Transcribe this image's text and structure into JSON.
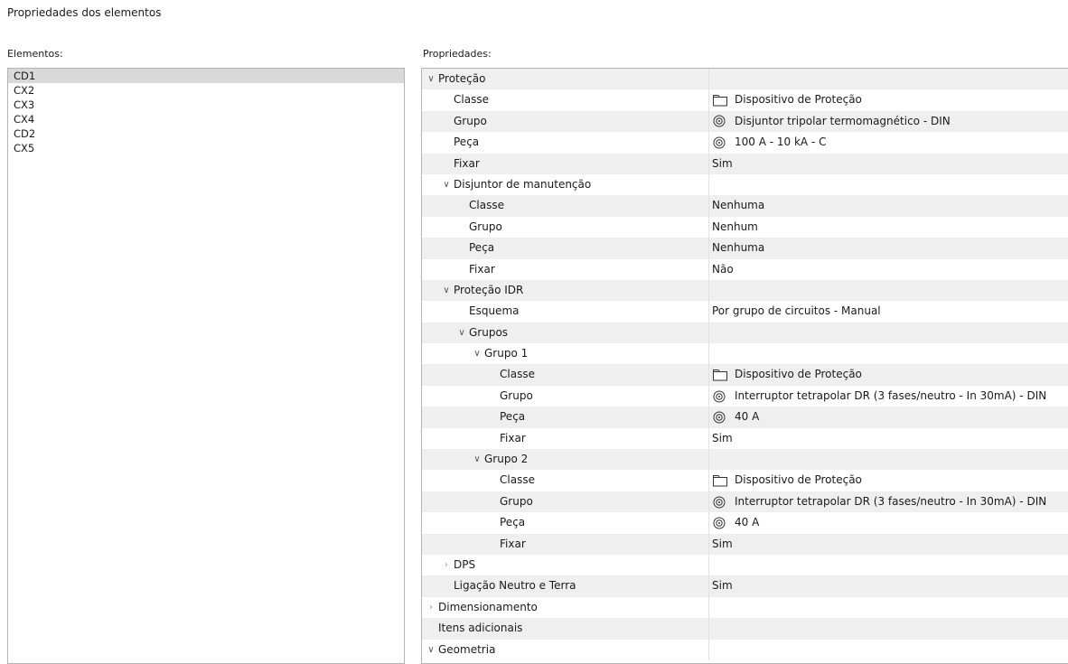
{
  "window": {
    "title": "Propriedades dos elementos"
  },
  "elements": {
    "label": "Elementos:",
    "items": [
      "CD1",
      "CX2",
      "CX3",
      "CX4",
      "CD2",
      "CX5"
    ],
    "selected": "CD1"
  },
  "properties": {
    "label": "Propriedades:",
    "rows": [
      {
        "name": "Proteção",
        "value": "",
        "depth": 0,
        "expander": "expanded",
        "icon": ""
      },
      {
        "name": "Classe",
        "value": "Dispositivo de Proteção",
        "depth": 1,
        "expander": "",
        "icon": "folder-icon"
      },
      {
        "name": "Grupo",
        "value": "Disjuntor tripolar termomagnético - DIN",
        "depth": 1,
        "expander": "",
        "icon": "target-icon"
      },
      {
        "name": "Peça",
        "value": "100 A - 10 kA - C",
        "depth": 1,
        "expander": "",
        "icon": "target-icon"
      },
      {
        "name": "Fixar",
        "value": "Sim",
        "depth": 1,
        "expander": "",
        "icon": ""
      },
      {
        "name": "Disjuntor de manutenção",
        "value": "",
        "depth": 1,
        "expander": "expanded",
        "icon": ""
      },
      {
        "name": "Classe",
        "value": "Nenhuma",
        "depth": 2,
        "expander": "",
        "icon": ""
      },
      {
        "name": "Grupo",
        "value": "Nenhum",
        "depth": 2,
        "expander": "",
        "icon": ""
      },
      {
        "name": "Peça",
        "value": "Nenhuma",
        "depth": 2,
        "expander": "",
        "icon": ""
      },
      {
        "name": "Fixar",
        "value": "Não",
        "depth": 2,
        "expander": "",
        "icon": ""
      },
      {
        "name": "Proteção IDR",
        "value": "",
        "depth": 1,
        "expander": "expanded",
        "icon": ""
      },
      {
        "name": "Esquema",
        "value": "Por grupo de circuitos - Manual",
        "depth": 2,
        "expander": "",
        "icon": ""
      },
      {
        "name": "Grupos",
        "value": "",
        "depth": 2,
        "expander": "expanded",
        "icon": ""
      },
      {
        "name": "Grupo 1",
        "value": "",
        "depth": 3,
        "expander": "expanded",
        "icon": ""
      },
      {
        "name": "Classe",
        "value": "Dispositivo de Proteção",
        "depth": 4,
        "expander": "",
        "icon": "folder-icon"
      },
      {
        "name": "Grupo",
        "value": "Interruptor tetrapolar DR (3 fases/neutro - In 30mA) - DIN",
        "depth": 4,
        "expander": "",
        "icon": "target-icon"
      },
      {
        "name": "Peça",
        "value": "40 A",
        "depth": 4,
        "expander": "",
        "icon": "target-icon"
      },
      {
        "name": "Fixar",
        "value": "Sim",
        "depth": 4,
        "expander": "",
        "icon": ""
      },
      {
        "name": "Grupo 2",
        "value": "",
        "depth": 3,
        "expander": "expanded",
        "icon": ""
      },
      {
        "name": "Classe",
        "value": "Dispositivo de Proteção",
        "depth": 4,
        "expander": "",
        "icon": "folder-icon"
      },
      {
        "name": "Grupo",
        "value": "Interruptor tetrapolar DR (3 fases/neutro - In 30mA) - DIN",
        "depth": 4,
        "expander": "",
        "icon": "target-icon"
      },
      {
        "name": "Peça",
        "value": "40 A",
        "depth": 4,
        "expander": "",
        "icon": "target-icon"
      },
      {
        "name": "Fixar",
        "value": "Sim",
        "depth": 4,
        "expander": "",
        "icon": ""
      },
      {
        "name": "DPS",
        "value": "",
        "depth": 1,
        "expander": "collapsed",
        "icon": ""
      },
      {
        "name": "Ligação Neutro e Terra",
        "value": "Sim",
        "depth": 1,
        "expander": "",
        "icon": ""
      },
      {
        "name": "Dimensionamento",
        "value": "",
        "depth": 0,
        "expander": "collapsed",
        "icon": ""
      },
      {
        "name": "Itens adicionais",
        "value": "",
        "depth": 0,
        "expander": "",
        "icon": ""
      },
      {
        "name": "Geometria",
        "value": "",
        "depth": 0,
        "expander": "expanded",
        "icon": ""
      }
    ]
  },
  "colors": {
    "selection": "#d9d9d9",
    "row_shade": "#efefef",
    "border": "#b4b4b4"
  }
}
